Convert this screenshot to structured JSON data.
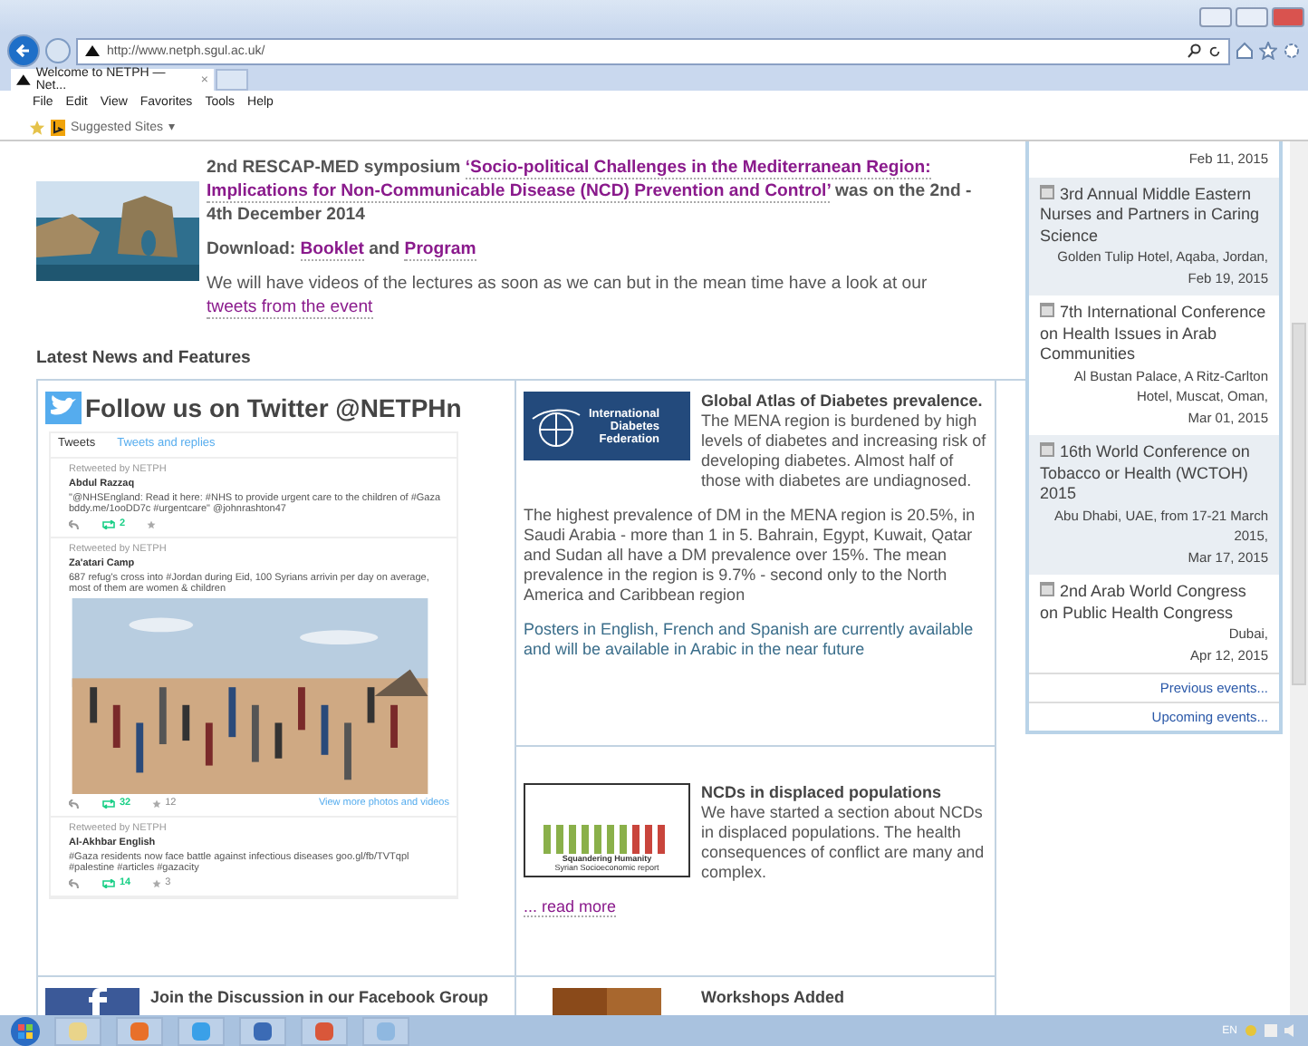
{
  "browser": {
    "url": "http://www.netph.sgul.ac.uk/",
    "tab_title": "Welcome to NETPH — Net...",
    "tab_close": "×",
    "menu": [
      "File",
      "Edit",
      "View",
      "Favorites",
      "Tools",
      "Help"
    ],
    "favorites": "Suggested Sites",
    "favorites_caret": "▾"
  },
  "symposium": {
    "intro": "2nd RESCAP-MED symposium",
    "title_lines": [
      "‘Socio-political Challenges in the Mediterranean Region:",
      "Implications for Non-Communicable Disease (NCD) Prevention and Control’"
    ],
    "after": "was on the 2nd - 4th December 2014",
    "download_label": "Download:",
    "links": [
      "Booklet",
      "Program"
    ],
    "and": "and",
    "videos_text": "We will have videos of the lectures as soon as we can but in the mean time have a look at our",
    "videos_link": "tweets from the event"
  },
  "news_heading": "Latest News and Features",
  "twitter": {
    "heading": "Follow us on Twitter @NETPHn",
    "tabs": [
      {
        "label": "Tweets",
        "selected": true
      },
      {
        "label": "Tweets and replies",
        "selected": false
      }
    ],
    "tweets": [
      {
        "retweeted": "Retweeted by NETPH",
        "author": "Abdul Razzaq",
        "text": "\"@NHSEngland: Read it here: #NHS to provide urgent care to the children of #Gaza bddy.me/1ooDD7c #urgentcare\" @johnrashton47",
        "retweets": "2",
        "photo": false
      },
      {
        "retweeted": "Retweeted by NETPH",
        "author": "Za'atari Camp",
        "text": "687 refug's cross into #Jordan during Eid, 100 Syrians arrivin per day on average, most of them are women & children",
        "retweets": "32",
        "favorites": "12",
        "photo": true,
        "more": "View more photos and videos"
      },
      {
        "retweeted": "Retweeted by NETPH",
        "author": "Al-Akhbar English",
        "text": "#Gaza residents now face battle against infectious diseases goo.gl/fb/TVTqpl #palestine #articles #gazacity",
        "retweets": "14",
        "favorites": "3",
        "photo": false
      }
    ]
  },
  "facebook": {
    "title": "Join the Discussion in our Facebook Group"
  },
  "news": [
    {
      "kind": "idf",
      "logo_lines": [
        "International",
        "Diabetes",
        "Federation"
      ],
      "title": "Global Atlas of Diabetes prevalence.",
      "summary": "The MENA region is burdened by high levels of diabetes and increasing risk of developing diabetes. Almost half of those with diabetes are undiagnosed.",
      "paragraphs": [
        "The highest prevalence of DM in the MENA region is 20.5%, in Saudi Arabia - more than 1 in 5. Bahrain, Egypt, Kuwait, Qatar and Sudan all have a DM prevalence over 15%. The mean prevalence in the region is 9.7% - second only to the North America and Caribbean region",
        "Posters in English, French and Spanish are currently available and will be available in Arabic in the near future"
      ]
    },
    {
      "kind": "report",
      "logo_lines": [
        "Squandering Humanity",
        "Syrian Socioeconomic report"
      ],
      "title": "NCDs in displaced populations",
      "summary": "We have started a section about NCDs in displaced populations. The health consequences of conflict are many and complex.",
      "more": "... read more"
    },
    {
      "title": "Workshops Added"
    }
  ],
  "events": [
    {
      "date": "Feb 11, 2015"
    },
    {
      "title": "3rd Annual Middle Eastern Nurses and Partners in Caring Science",
      "place": "Golden Tulip Hotel, Aqaba, Jordan,",
      "date": "Feb 19, 2015"
    },
    {
      "title": "7th International Conference on Health Issues in Arab Communities",
      "place": "Al Bustan Palace, A Ritz-Carlton Hotel, Muscat, Oman,",
      "date": "Mar 01, 2015"
    },
    {
      "title": "16th World Conference on Tobacco or Health (WCTOH) 2015",
      "place": "Abu Dhabi, UAE, from 17-21 March 2015,",
      "date": "Mar 17, 2015"
    },
    {
      "title": "2nd Arab World Congress on Public Health Congress",
      "place": "Dubai,",
      "date": "Apr 12, 2015"
    }
  ],
  "event_links": [
    "Previous events...",
    "Upcoming events..."
  ],
  "taskbar": {
    "language": "EN"
  }
}
